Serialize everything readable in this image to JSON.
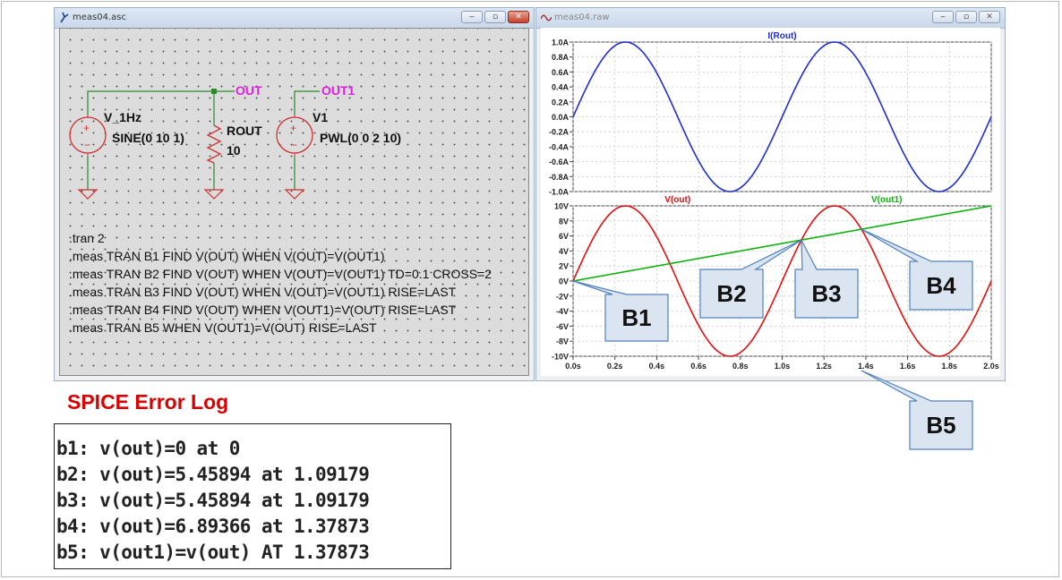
{
  "schematic_window": {
    "title": "meas04.asc",
    "buttons": {
      "minimize": "‒",
      "restore": "▫",
      "close": "✕"
    },
    "components": {
      "v_1hz_name": "V_1Hz",
      "v_1hz_value": "SINE(0 10 1)",
      "rout_name": "ROUT",
      "rout_value": "10",
      "v1_name": "V1",
      "v1_value": "PWL(0 0 2 10)"
    },
    "nets": {
      "out": "OUT",
      "out1": "OUT1"
    },
    "directives": [
      ".tran 2",
      ".meas TRAN B1 FIND V(OUT) WHEN V(OUT)=V(OUT1)",
      ".meas TRAN B2 FIND V(OUT) WHEN V(OUT)=V(OUT1) TD=0.1 CROSS=2",
      ".meas TRAN B3 FIND V(OUT) WHEN V(OUT)=V(OUT1) RISE=LAST",
      ".meas TRAN B4 FIND V(OUT) WHEN V(OUT1)=V(OUT) RISE=LAST",
      ".meas TRAN B5 WHEN V(OUT1)=V(OUT) RISE=LAST"
    ]
  },
  "waveform_window": {
    "title": "meas04.raw",
    "buttons": {
      "minimize": "‒",
      "restore": "▫",
      "close": "✕"
    }
  },
  "colors": {
    "blue_trace": "#1f2fd0",
    "red_trace": "#e01010",
    "green_trace": "#10b010",
    "net_label": "#e020e0",
    "error_title": "#d80000",
    "callout_fill": "#dbe5f1",
    "callout_stroke": "#4f81bd"
  },
  "chart_data": [
    {
      "type": "line",
      "title": "I(Rout)",
      "series": [
        {
          "name": "I(Rout)",
          "function": "1.0*sin(2*pi*1*t)",
          "color": "#1f2fd0"
        }
      ],
      "ylim": [
        -1.0,
        1.0
      ],
      "xlim": [
        0,
        2.0
      ],
      "y_ticks": [
        "1.0A",
        "0.8A",
        "0.6A",
        "0.4A",
        "0.2A",
        "0.0A",
        "-0.2A",
        "-0.4A",
        "-0.6A",
        "-0.8A",
        "-1.0A"
      ],
      "grid": true
    },
    {
      "type": "line",
      "series": [
        {
          "name": "V(out)",
          "function": "10*sin(2*pi*1*t)",
          "color": "#e01010"
        },
        {
          "name": "V(out1)",
          "function": "5*t",
          "color": "#10b010"
        }
      ],
      "ylim": [
        -10,
        10
      ],
      "xlim": [
        0,
        2.0
      ],
      "y_ticks": [
        "10V",
        "8V",
        "6V",
        "4V",
        "2V",
        "0V",
        "-2V",
        "-4V",
        "-6V",
        "-8V",
        "-10V"
      ],
      "x_ticks": [
        "0.0s",
        "0.2s",
        "0.4s",
        "0.6s",
        "0.8s",
        "1.0s",
        "1.2s",
        "1.4s",
        "1.6s",
        "1.8s",
        "2.0s"
      ],
      "grid": true
    }
  ],
  "callouts": [
    {
      "label": "B1",
      "t": 0.0,
      "v": 0
    },
    {
      "label": "B2",
      "t": 1.09179,
      "v": 5.45894
    },
    {
      "label": "B3",
      "t": 1.09179,
      "v": 5.45894
    },
    {
      "label": "B4",
      "t": 1.37873,
      "v": 6.89366
    },
    {
      "label": "B5",
      "t": 1.37873
    }
  ],
  "error_log": {
    "title": "SPICE Error Log",
    "lines": [
      "b1: v(out)=0 at 0",
      "b2: v(out)=5.45894 at 1.09179",
      "b3: v(out)=5.45894 at 1.09179",
      "b4: v(out)=6.89366 at 1.37873",
      "b5: v(out1)=v(out) AT 1.37873"
    ]
  }
}
